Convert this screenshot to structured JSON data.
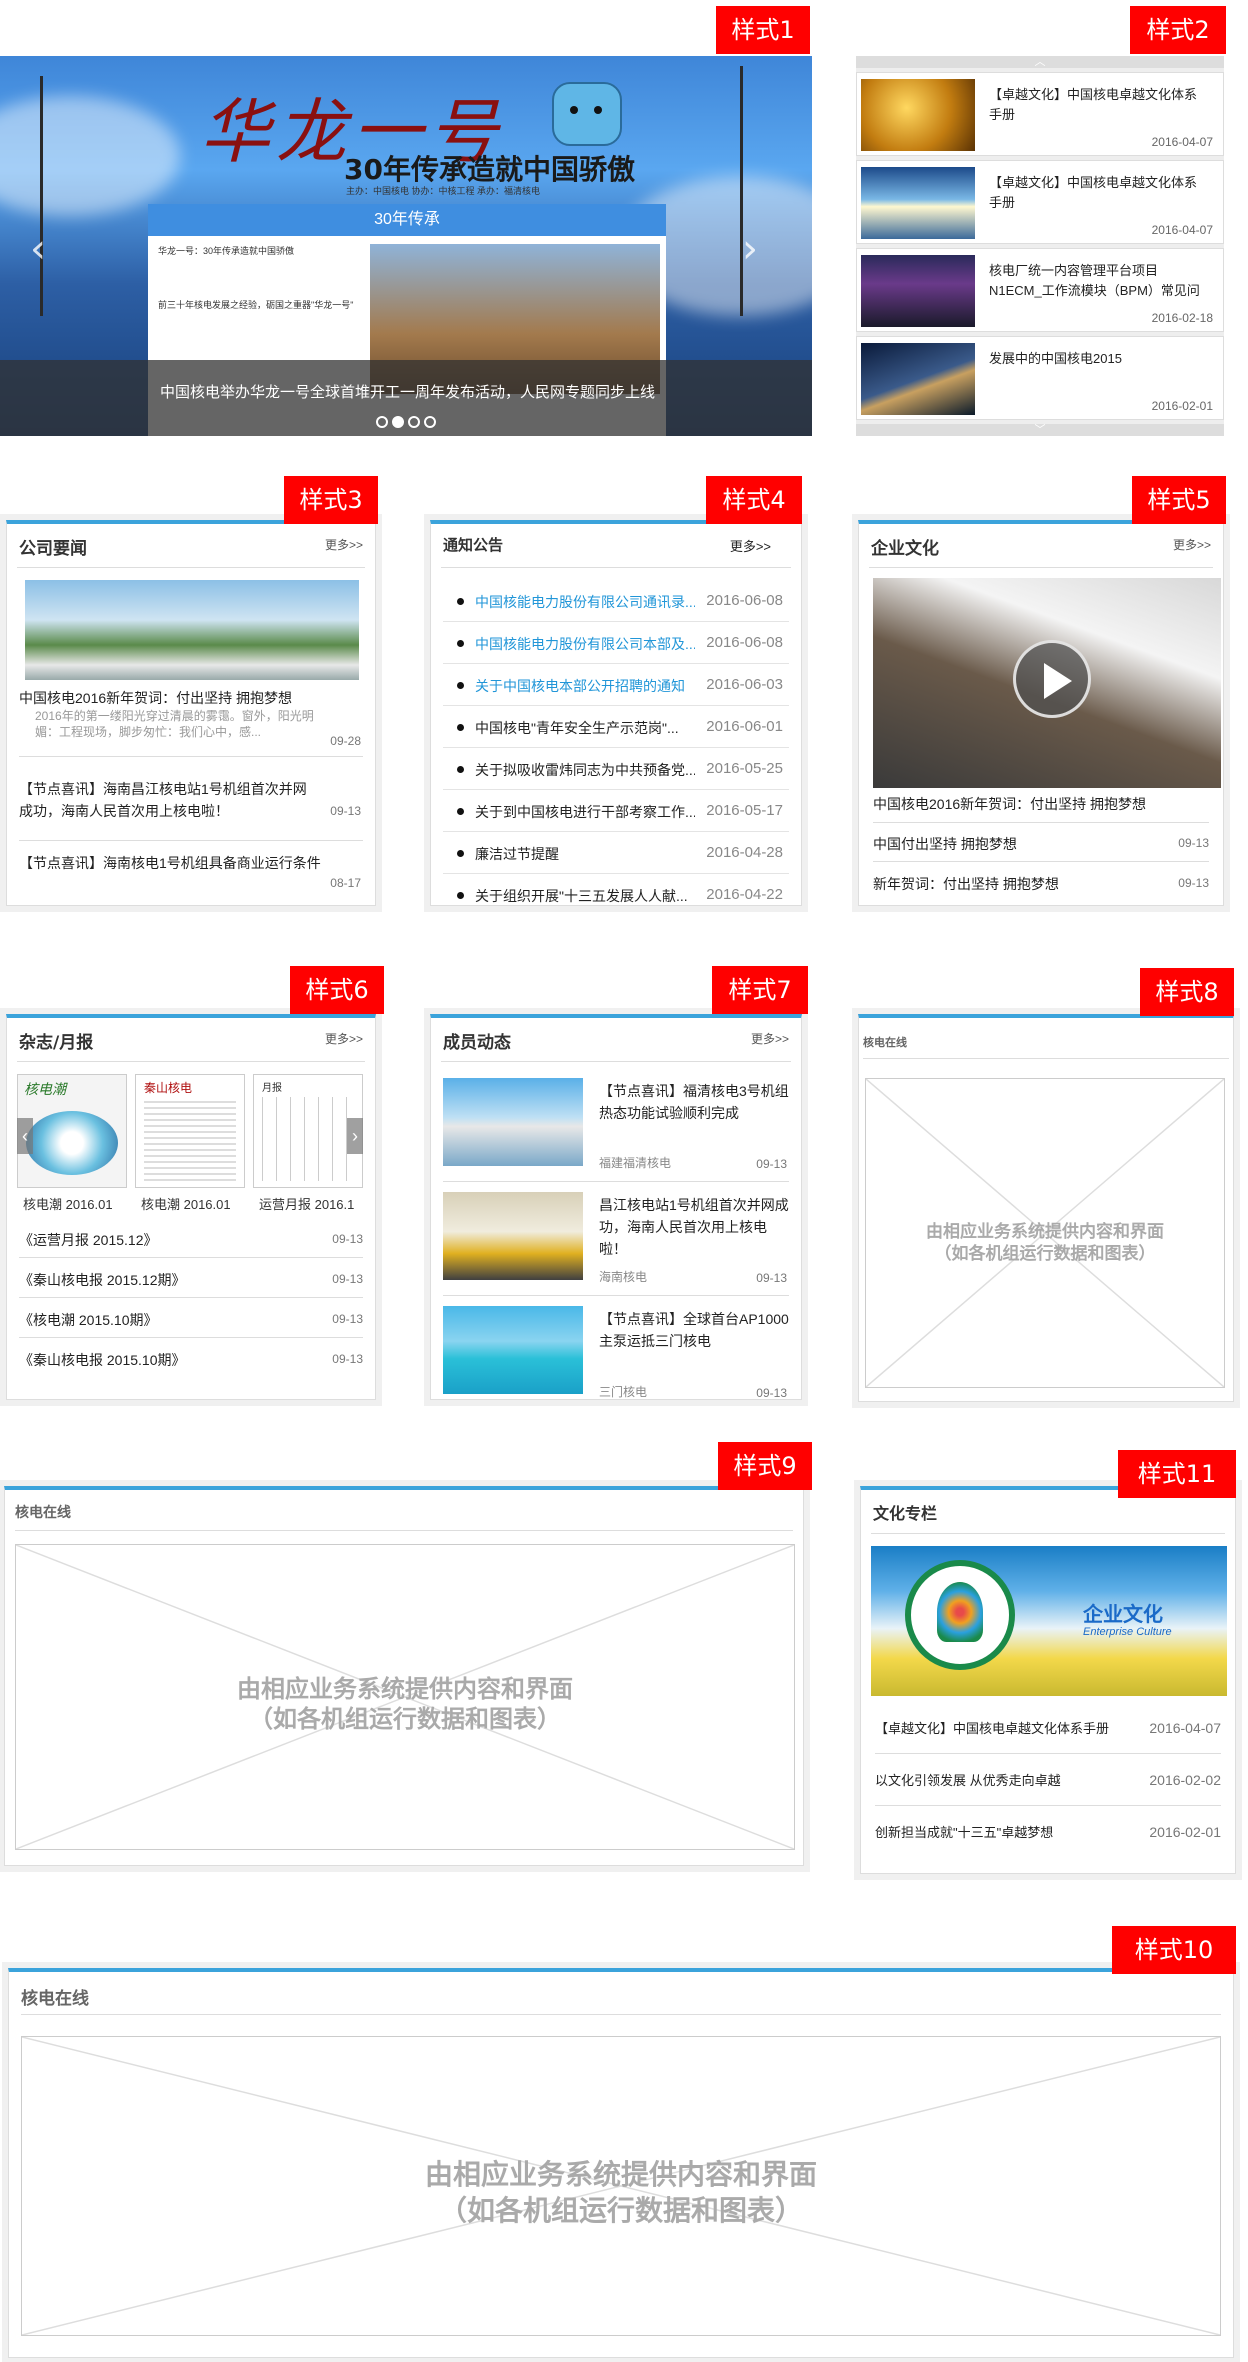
{
  "tags": {
    "s1": "样式1",
    "s2": "样式2",
    "s3": "样式3",
    "s4": "样式4",
    "s5": "样式5",
    "s6": "样式6",
    "s7": "样式7",
    "s8": "样式8",
    "s9": "样式9",
    "s11": "样式11",
    "s10": "样式10"
  },
  "banner": {
    "title": "华龙一号",
    "subtitle": "30年传承造就中国骄傲",
    "sponsor": "主办：中国核电   协办：中核工程   承办：福清核电",
    "card_head": "30年传承",
    "card_lines": [
      "华龙一号：30年传承造就中国骄傲",
      "前三十年核电发展之经验，砺国之重器\"华龙一号\""
    ],
    "caption": "中国核电举办华龙一号全球首堆开工一周年发布活动，人民网专题同步上线",
    "prev": "‹",
    "next": "›"
  },
  "s2": {
    "items": [
      {
        "title": "【卓越文化】中国核电卓越文化体系手册",
        "date": "2016-04-07"
      },
      {
        "title": "【卓越文化】中国核电卓越文化体系手册",
        "date": "2016-04-07"
      },
      {
        "title": "核电厂统一内容管理平台项目N1ECM_工作流模块（BPM）常见问",
        "date": "2016-02-18"
      },
      {
        "title": "发展中的中国核电2015",
        "date": "2016-02-01"
      }
    ],
    "up": "︿",
    "down": "﹀"
  },
  "s3": {
    "title": "公司要闻",
    "more": "更多>>",
    "feature": {
      "title": "中国核电2016新年贺词：付出坚持 拥抱梦想",
      "desc": "2016年的第一缕阳光穿过清晨的雾霭。窗外，阳光明媚：工程现场，脚步匆忙：我们心中，感...",
      "date": "09-28"
    },
    "items": [
      {
        "title": "【节点喜讯】海南昌江核电站1号机组首次并网成功，海南人民首次用上核电啦！",
        "date": "09-13"
      },
      {
        "title": "【节点喜讯】海南核电1号机组具备商业运行条件",
        "date": "08-17"
      }
    ]
  },
  "s4": {
    "title": "通知公告",
    "more": "更多>>",
    "items": [
      {
        "title": "中国核能电力股份有限公司通讯录...",
        "date": "2016-06-08",
        "blue": true
      },
      {
        "title": "中国核能电力股份有限公司本部及...",
        "date": "2016-06-08",
        "blue": true
      },
      {
        "title": "关于中国核电本部公开招聘的通知",
        "date": "2016-06-03",
        "blue": true
      },
      {
        "title": "中国核电\"青年安全生产示范岗\"...",
        "date": "2016-06-01",
        "blue": false
      },
      {
        "title": "关于拟吸收雷炜同志为中共预备党...",
        "date": "2016-05-25",
        "blue": false
      },
      {
        "title": "关于到中国核电进行干部考察工作...",
        "date": "2016-05-17",
        "blue": false
      },
      {
        "title": "廉洁过节提醒",
        "date": "2016-04-28",
        "blue": false
      },
      {
        "title": "关于组织开展\"十三五发展人人献...",
        "date": "2016-04-22",
        "blue": false
      }
    ]
  },
  "s5": {
    "title": "企业文化",
    "more": "更多>>",
    "video_title": "中国核电2016新年贺词：付出坚持 拥抱梦想",
    "items": [
      {
        "title": "中国付出坚持 拥抱梦想",
        "date": "09-13"
      },
      {
        "title": "新年贺词：付出坚持 拥抱梦想",
        "date": "09-13"
      }
    ]
  },
  "s6": {
    "title": "杂志/月报",
    "more": "更多>>",
    "covers": [
      {
        "label": "核电潮 2016.01",
        "mast": "核电潮"
      },
      {
        "label": "核电潮 2016.01",
        "mast": "秦山核电"
      },
      {
        "label": "运营月报 2016.1",
        "mast": "月报"
      }
    ],
    "items": [
      {
        "title": "《运营月报 2015.12》",
        "date": "09-13"
      },
      {
        "title": "《秦山核电报 2015.12期》",
        "date": "09-13"
      },
      {
        "title": "《核电潮 2015.10期》",
        "date": "09-13"
      },
      {
        "title": "《秦山核电报 2015.10期》",
        "date": "09-13"
      }
    ]
  },
  "s7": {
    "title": "成员动态",
    "more": "更多>>",
    "items": [
      {
        "title": "【节点喜讯】福清核电3号机组热态功能试验顺利完成",
        "source": "福建福清核电",
        "date": "09-13"
      },
      {
        "title": "昌江核电站1号机组首次并网成功，海南人民首次用上核电啦！",
        "source": "海南核电",
        "date": "09-13"
      },
      {
        "title": "【节点喜讯】全球首台AP1000主泵运抵三门核电",
        "source": "三门核电",
        "date": "09-13"
      }
    ]
  },
  "s8": {
    "title": "核电在线",
    "placeholder_1": "由相应业务系统提供内容和界面",
    "placeholder_2": "（如各机组运行数据和图表）"
  },
  "s9": {
    "title": "核电在线",
    "placeholder_1": "由相应业务系统提供内容和界面",
    "placeholder_2": "（如各机组运行数据和图表）"
  },
  "s11": {
    "title": "文化专栏",
    "banner_cn": "企业文化",
    "banner_en": "Enterprise Culture",
    "items": [
      {
        "title": "【卓越文化】中国核电卓越文化体系手册",
        "date": "2016-04-07"
      },
      {
        "title": "以文化引领发展 从优秀走向卓越",
        "date": "2016-02-02"
      },
      {
        "title": "创新担当成就\"十三五\"卓越梦想",
        "date": "2016-02-01"
      }
    ]
  },
  "s10": {
    "title": "核电在线",
    "placeholder_1": "由相应业务系统提供内容和界面",
    "placeholder_2": "（如各机组运行数据和图表）"
  }
}
